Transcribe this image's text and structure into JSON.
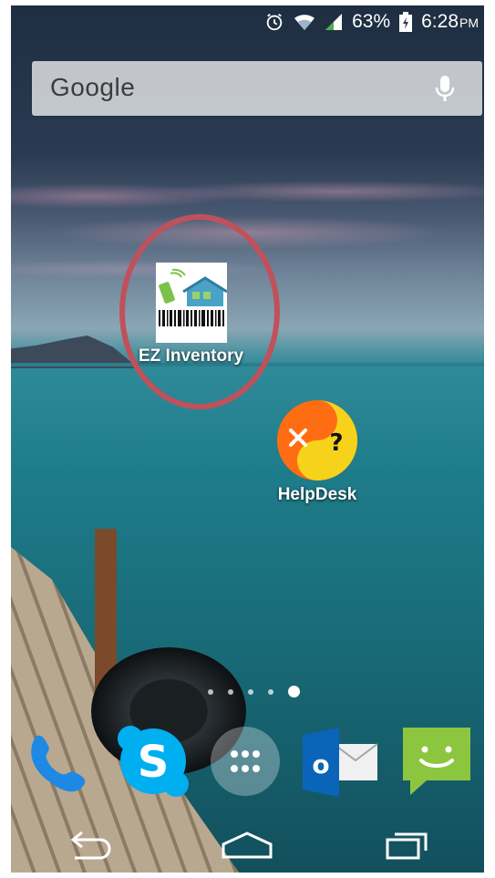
{
  "status_bar": {
    "battery": "63%",
    "time": "6:28",
    "ampm": "PM",
    "icons": [
      "alarm-icon",
      "wifi-icon",
      "signal-icon",
      "battery-charging-icon"
    ]
  },
  "search": {
    "logo": "Google",
    "icon": "mic-icon"
  },
  "apps": [
    {
      "label": "EZ Inventory",
      "icon": "ez-inventory-icon",
      "highlighted": true,
      "highlight_color": "#c0515a"
    },
    {
      "label": "HelpDesk",
      "icon": "helpdesk-icon"
    }
  ],
  "page_indicator": {
    "count": 5,
    "active": 5
  },
  "dock": [
    {
      "name": "phone",
      "icon": "phone-icon",
      "color": "#1e88e5"
    },
    {
      "name": "skype",
      "icon": "skype-icon",
      "color": "#00aff0"
    },
    {
      "name": "app-drawer",
      "icon": "app-drawer-icon"
    },
    {
      "name": "outlook",
      "icon": "outlook-icon",
      "color": "#0a64b8"
    },
    {
      "name": "messaging",
      "icon": "messaging-icon",
      "color": "#8cc63f"
    }
  ],
  "nav": [
    {
      "name": "back",
      "icon": "back-icon"
    },
    {
      "name": "home",
      "icon": "home-icon"
    },
    {
      "name": "recents",
      "icon": "recents-icon"
    }
  ]
}
